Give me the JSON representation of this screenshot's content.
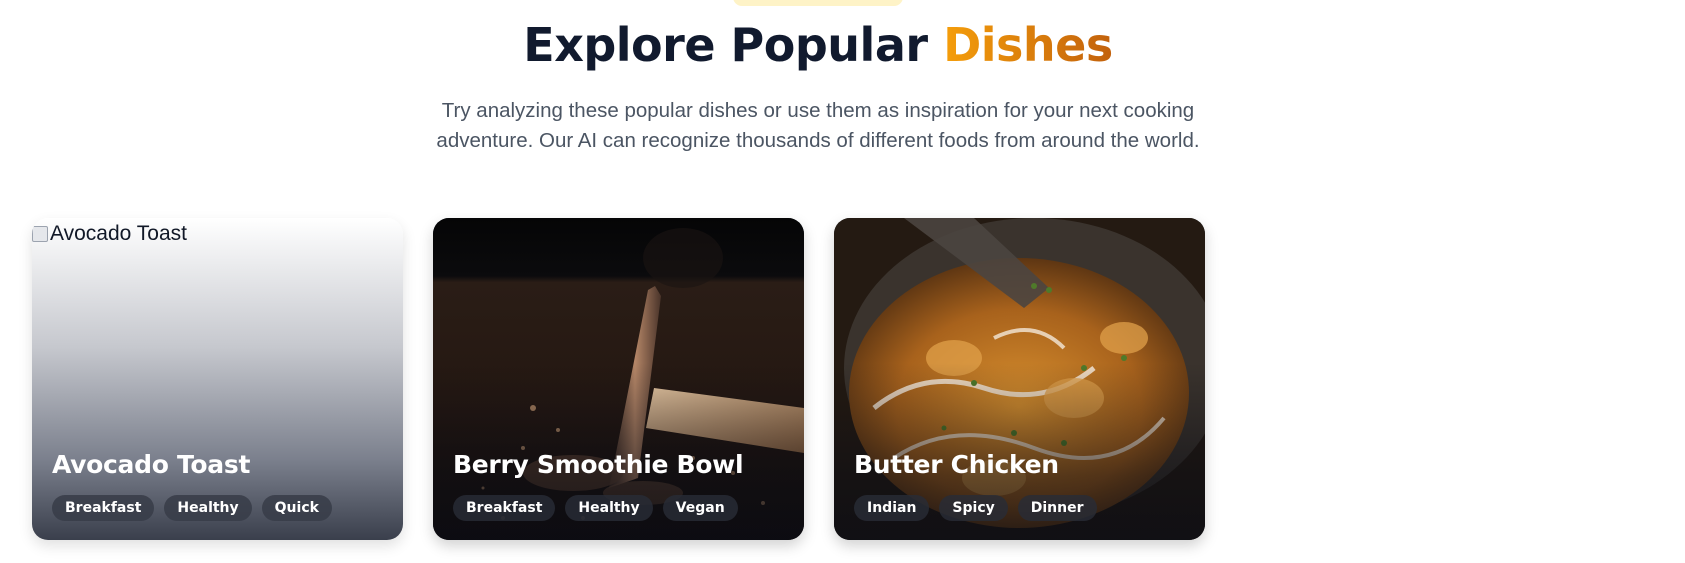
{
  "header": {
    "title_main": "Explore Popular",
    "title_accent": "Dishes",
    "subtitle": "Try analyzing these popular dishes or use them as inspiration for your next cooking adventure. Our AI can recognize thousands of different foods from around the world."
  },
  "colors": {
    "heading": "#111a2e",
    "accent_start": "#f59e0b",
    "accent_end": "#c2610c",
    "subtitle": "#4b5563"
  },
  "cards": [
    {
      "title": "Avocado Toast",
      "image_alt": "Avocado Toast",
      "tags": [
        "Breakfast",
        "Healthy",
        "Quick"
      ]
    },
    {
      "title": "Berry Smoothie Bowl",
      "tags": [
        "Breakfast",
        "Healthy",
        "Vegan"
      ]
    },
    {
      "title": "Butter Chicken",
      "tags": [
        "Indian",
        "Spicy",
        "Dinner"
      ]
    }
  ]
}
